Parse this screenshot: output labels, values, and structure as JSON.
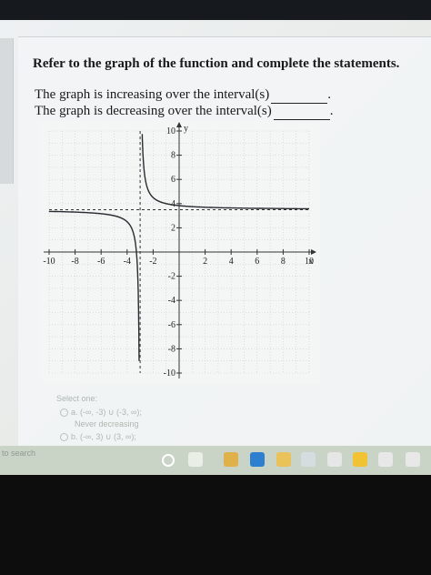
{
  "question": {
    "title": "Refer to the graph of the function and complete the statements.",
    "statements": [
      {
        "text": "The graph is increasing over the interval(s)",
        "end": "."
      },
      {
        "text": "The graph is decreasing over the interval(s)",
        "end": "."
      }
    ]
  },
  "graph": {
    "x_ticks": [
      "-10",
      "-8",
      "-6",
      "-4",
      "-2",
      "2",
      "4",
      "6",
      "8",
      "10"
    ],
    "y_ticks_pos": [
      "10",
      "8",
      "6",
      "4",
      "2"
    ],
    "y_ticks_neg": [
      "-2",
      "-4",
      "-6",
      "-8",
      "-10"
    ],
    "x_label": "x",
    "y_label": "y",
    "vertical_asymptote": -3,
    "horizontal_asymptote": 3.5,
    "xlim": [
      -10,
      10
    ],
    "ylim": [
      -10,
      10
    ]
  },
  "answer": {
    "prompt": "Select one:",
    "options": [
      {
        "label": "a. (-∞, -3) ∪ (-3, ∞);",
        "sub": "Never decreasing"
      },
      {
        "label": "b. (-∞, 3) ∪ (3, ∞);",
        "sub": ""
      }
    ]
  },
  "taskbar": {
    "search_hint": "to search",
    "icons": [
      "cortana-icon",
      "task-view-icon",
      "chrome-icon",
      "edge-icon",
      "file-explorer-icon",
      "store-icon",
      "amazon-icon",
      "winamp-icon",
      "dropbox-icon",
      "unknown-icon"
    ]
  }
}
